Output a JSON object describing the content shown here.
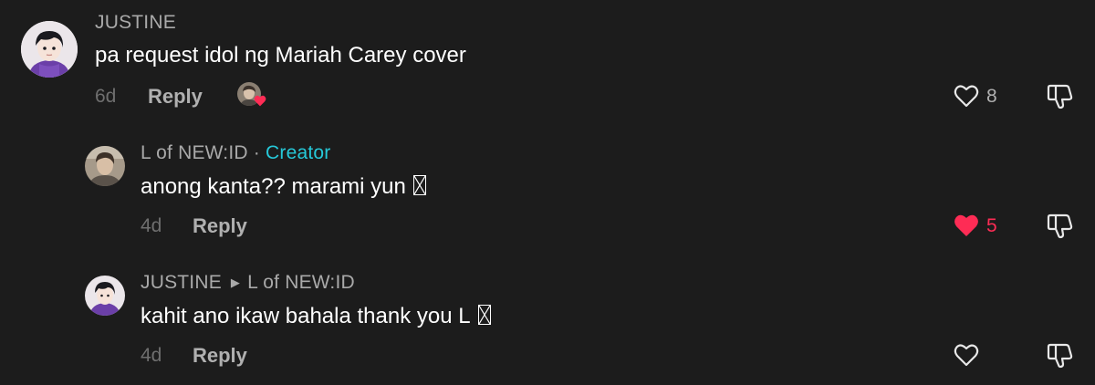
{
  "comments": [
    {
      "author": "JUSTINE",
      "text": "pa request idol ng Mariah Carey cover",
      "time": "6d",
      "reply_label": "Reply",
      "likes": "8",
      "liked": false
    },
    {
      "author": "L of NEW:ID",
      "separator": "·",
      "badge": "Creator",
      "text": "anong kanta?? marami yun",
      "time": "4d",
      "reply_label": "Reply",
      "likes": "5",
      "liked": true
    },
    {
      "author": "JUSTINE",
      "reply_to": "L of NEW:ID",
      "text": "kahit ano ikaw bahala thank you L",
      "time": "4d",
      "reply_label": "Reply",
      "likes": "",
      "liked": false
    }
  ],
  "colors": {
    "background": "#1c1c1c",
    "creator_badge": "#26c8d8",
    "liked_heart": "#fe2c55",
    "muted_text": "#a9a9a9"
  },
  "icons": [
    "heart-outline-icon",
    "heart-filled-icon",
    "dislike-icon",
    "reply-arrow-icon"
  ]
}
